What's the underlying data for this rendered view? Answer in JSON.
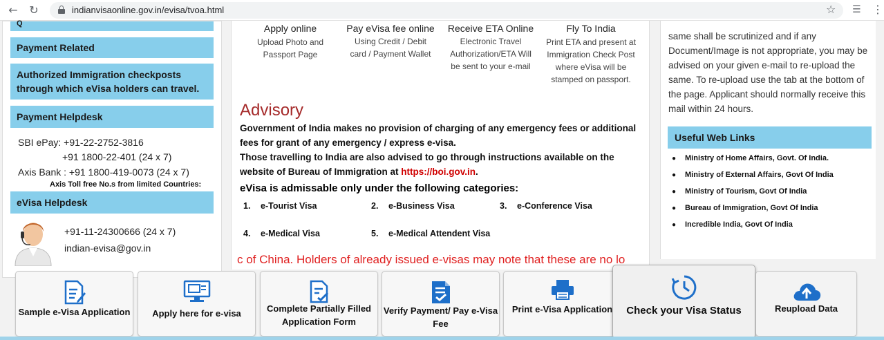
{
  "browser": {
    "url": "indianvisaonline.gov.in/evisa/tvoa.html"
  },
  "sidebar": {
    "partial_heading": "Q",
    "headings": [
      "Payment Related",
      "Authorized Immigration checkposts through which eVisa holders can travel.",
      "Payment Helpdesk"
    ],
    "helpdesk_lines": [
      "SBI ePay: +91-22-2752-3816",
      "+91 1800-22-401 (24 x 7)",
      "Axis Bank : +91 1800-419-0073 (24 x 7)"
    ],
    "toll_free_note": "Axis Toll free No.s from limited Countries:",
    "evisa_helpdesk_heading": "eVisa Helpdesk",
    "evisa_phone": "+91-11-24300666 (24 x 7)",
    "evisa_email": "indian-evisa@gov.in"
  },
  "steps": [
    {
      "title": "Apply online",
      "description": "Upload Photo and Passport Page"
    },
    {
      "title": "Pay eVisa fee online",
      "description": "Using Credit / Debit card / Payment Wallet"
    },
    {
      "title": "Receive ETA Online",
      "description": "Electronic Travel Authorization/ETA Will be sent to your e-mail"
    },
    {
      "title": "Fly To India",
      "description": "Print ETA and present at Immigration Check Post where eVisa will be stamped on passport."
    }
  ],
  "advisory": {
    "title": "Advisory",
    "paragraph1": "Government of India makes no provision of charging of any emergency fees or additional fees for grant of any emergency / express e-visa.",
    "paragraph2_prefix": "Those travelling to India are also advised to go through instructions available on the website of Bureau of Immigration at ",
    "paragraph2_link": "https://boi.gov.in",
    "paragraph2_suffix": ".",
    "categories_title": "eVisa is admissable only under the following categories:",
    "categories": [
      {
        "num": "1.",
        "label": "e-Tourist Visa"
      },
      {
        "num": "2.",
        "label": "e-Business Visa"
      },
      {
        "num": "3.",
        "label": "e-Conference Visa"
      },
      {
        "num": "4.",
        "label": "e-Medical Visa"
      },
      {
        "num": "5.",
        "label": "e-Medical Attendent Visa"
      }
    ],
    "marquee": "c of China. Holders of already issued e-visas may note that these are no lo"
  },
  "right_panel": {
    "text": "same shall be scrutinized and if any Document/Image is not appropriate, you may be advised on your given e-mail to re-upload the same. To re-upload use the tab at the bottom of the page. Applicant should normally receive this mail within 24 hours.",
    "useful_links_heading": "Useful Web Links",
    "links": [
      "Ministry of Home Affairs, Govt. Of India.",
      "Ministry of External Affairs, Govt Of India",
      "Ministry of Tourism, Govt Of India",
      "Bureau of Immigration, Govt Of India",
      "Incredible India, Govt Of India"
    ]
  },
  "actions": {
    "sample": "Sample e-Visa Application",
    "apply": "Apply here for e-visa",
    "complete": "Complete Partially Filled Application Form",
    "verify": "Verify Payment/ Pay e-Visa Fee",
    "print": "Print e-Visa Application",
    "status": "Check your Visa Status",
    "reupload": "Reupload Data"
  },
  "colors": {
    "section_heading_bg": "#87ceeb",
    "advisory_title": "#a52a2a",
    "alert_red": "#e02020",
    "icon_blue": "#1e6fc9"
  }
}
